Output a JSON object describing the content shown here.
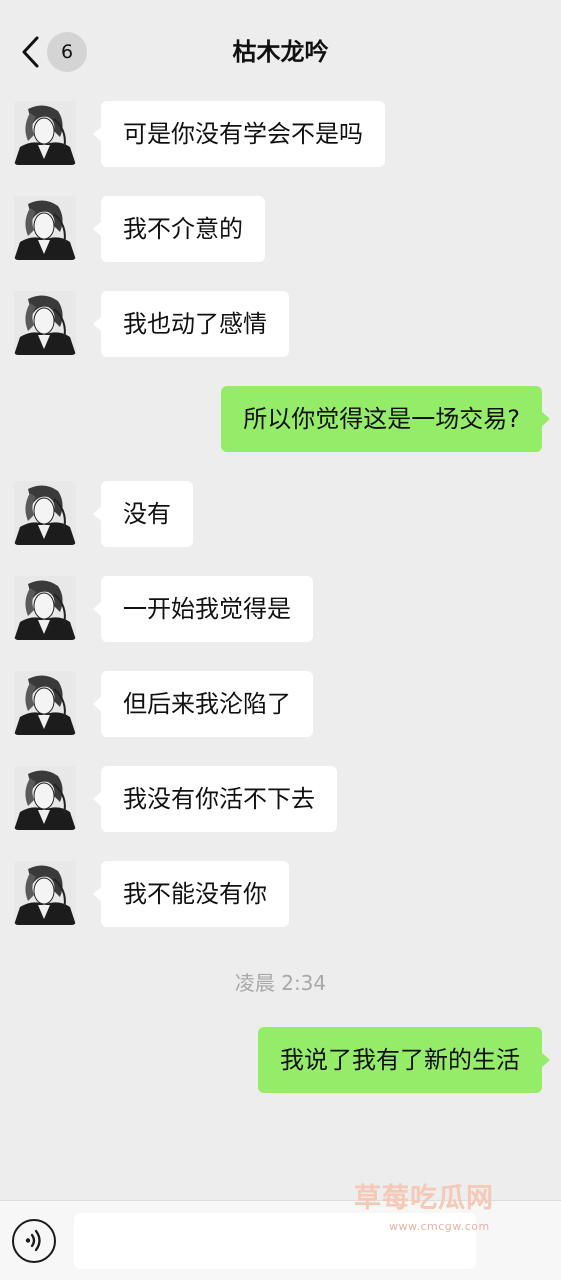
{
  "header": {
    "title": "枯木龙吟",
    "unread_count": "6"
  },
  "messages": [
    {
      "from": "contact",
      "text": "可是你没有学会不是吗"
    },
    {
      "from": "contact",
      "text": "我不介意的"
    },
    {
      "from": "contact",
      "text": "我也动了感情"
    },
    {
      "from": "me",
      "text": "所以你觉得这是一场交易?"
    },
    {
      "from": "contact",
      "text": "没有"
    },
    {
      "from": "contact",
      "text": "一开始我觉得是"
    },
    {
      "from": "contact",
      "text": "但后来我沦陷了"
    },
    {
      "from": "contact",
      "text": "我没有你活不下去"
    },
    {
      "from": "contact",
      "text": "我不能没有你"
    },
    {
      "from": "me",
      "text": "我说了我有了新的生活"
    }
  ],
  "timestamp": "凌晨 2:34",
  "watermark": {
    "text": "草莓吃瓜网",
    "url": "www.cmcgw.com"
  },
  "input": {
    "value": "",
    "placeholder": ""
  },
  "icons": {
    "back": "chevron-left-icon",
    "voice": "voice-icon"
  },
  "colors": {
    "background": "#ededed",
    "incoming_bubble": "#ffffff",
    "outgoing_bubble": "#95ec69"
  }
}
